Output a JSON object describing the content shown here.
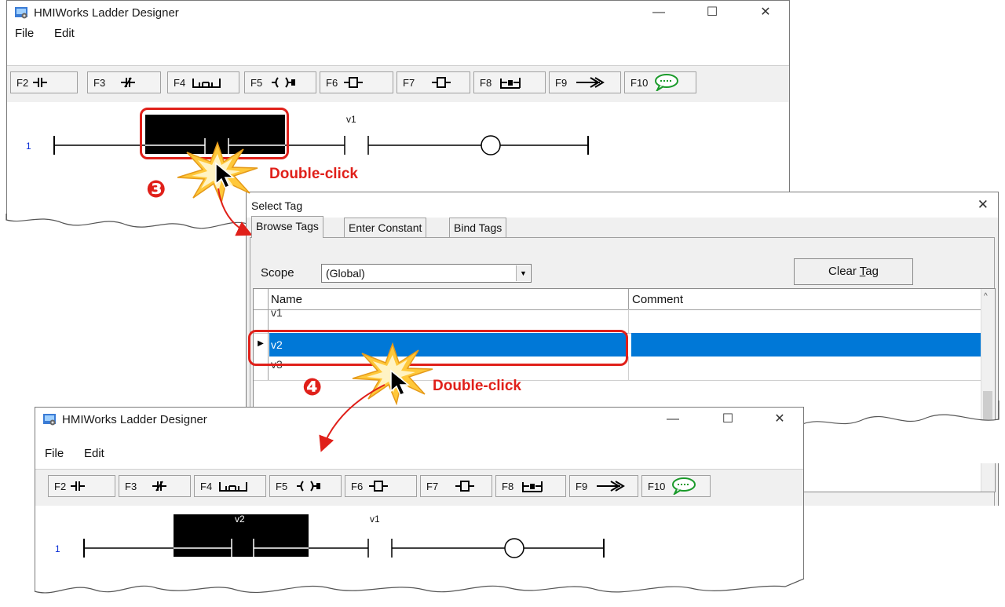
{
  "window_top": {
    "title": "HMIWorks Ladder Designer",
    "menu": [
      "File",
      "Edit"
    ],
    "toolbar": [
      "F2",
      "F3",
      "F4",
      "F5",
      "F6",
      "F7",
      "F8",
      "F9",
      "F10"
    ],
    "rung_number": "1",
    "coil_tag": "v1"
  },
  "dialog": {
    "title": "Select Tag",
    "close_glyph": "✕",
    "tabs": [
      "Browse Tags",
      "Enter Constant",
      "Bind Tags"
    ],
    "scope_label": "Scope",
    "scope_value": "(Global)",
    "clear_tag_prefix": "Clear ",
    "clear_tag_accel": "T",
    "clear_tag_suffix": "ag",
    "columns": [
      "Name",
      "Comment"
    ],
    "rows": [
      {
        "name": "v1",
        "comment": ""
      },
      {
        "name": "v2",
        "comment": "",
        "selected": true
      },
      {
        "name": "v3",
        "comment": ""
      }
    ]
  },
  "window_bottom": {
    "title": "HMIWorks Ladder Designer",
    "menu": [
      "File",
      "Edit"
    ],
    "toolbar": [
      "F2",
      "F3",
      "F4",
      "F5",
      "F6",
      "F7",
      "F8",
      "F9",
      "F10"
    ],
    "rung_number": "1",
    "contact_tag": "v2",
    "coil_tag": "v1"
  },
  "annotations": {
    "step3": "❸",
    "step4": "❹",
    "action_text": "Double-click"
  },
  "colors": {
    "highlight_red": "#e0201a",
    "selection_blue": "#0078d7",
    "rung_number_blue": "#0b2fd6",
    "burst_yellow": "#ffc83a"
  },
  "icons": [
    "app-icon",
    "minimize-icon",
    "maximize-icon",
    "close-icon",
    "dropdown-arrow-icon",
    "row-pointer-icon",
    "scroll-up-icon",
    "mouse-cursor-icon",
    "click-burst-icon"
  ]
}
